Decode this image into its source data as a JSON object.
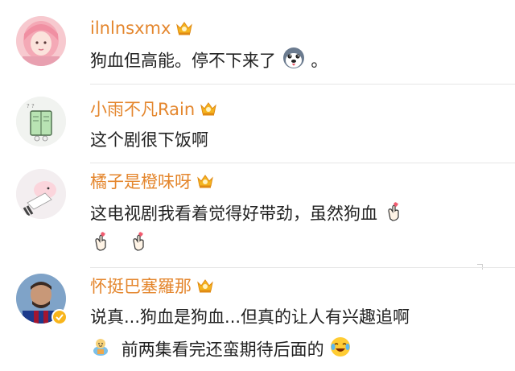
{
  "comments": [
    {
      "username": "ilnlnsxmx",
      "lines": [
        "狗血但高能。停不下来了",
        "。"
      ]
    },
    {
      "username": "小雨不凡Rain",
      "lines": [
        "这个剧很下饭啊"
      ]
    },
    {
      "username": "橘子是橙味呀",
      "lines": [
        "这电视剧我看着觉得好带劲，虽然狗血"
      ]
    },
    {
      "username": "怀挺巴塞羅那",
      "lines": [
        "说真...狗血是狗血...但真的让人有兴趣追啊",
        "前两集看完还蛮期待后面的"
      ]
    }
  ],
  "colors": {
    "username": "#e4862d",
    "text": "#222222",
    "crown": "#f5b41f",
    "divider": "#e6e6e6"
  },
  "icons": {
    "badge": "crown-icon",
    "emoji_1": "husky-dog-emoji-icon",
    "emoji_2": "finger-heart-emoji-icon",
    "emoji_3": "gift-emoji-icon",
    "emoji_4": "crying-laugh-emoji-icon"
  }
}
